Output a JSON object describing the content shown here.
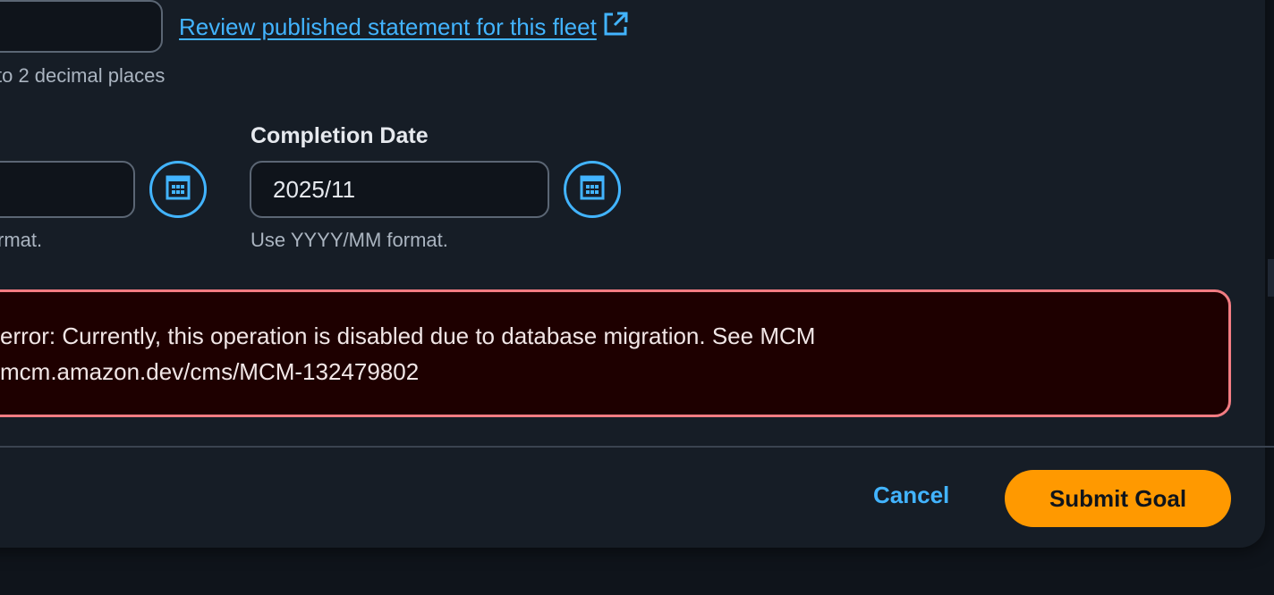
{
  "form": {
    "review_link": "Review published statement for this fleet",
    "decimal_hint": "to 2 decimal places",
    "start_date_hint": "rmat.",
    "completion_date": {
      "label": "Completion Date",
      "value": "2025/11",
      "hint": "Use YYYY/MM format."
    }
  },
  "alert": {
    "line1": "error: Currently, this operation is disabled due to database migration. See MCM",
    "line2": "mcm.amazon.dev/cms/MCM-132479802"
  },
  "footer": {
    "cancel_label": "Cancel",
    "submit_label": "Submit Goal"
  },
  "icons": {
    "external_link": "external-link-icon",
    "calendar": "calendar-icon"
  },
  "colors": {
    "background": "#161d26",
    "link": "#42b4ff",
    "error_border": "#f27c82",
    "error_bg": "#1e0000",
    "primary_button": "#ff9900"
  }
}
